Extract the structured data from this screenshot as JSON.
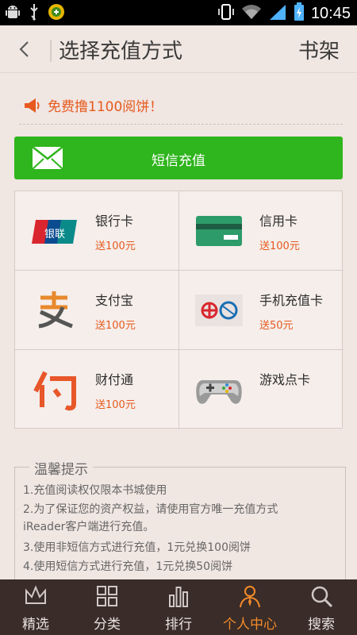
{
  "status_bar": {
    "time": "10:45"
  },
  "header": {
    "title": "选择充值方式",
    "right_link": "书架"
  },
  "promo": {
    "text": "免费撸1100阅饼！"
  },
  "sms": {
    "label": "短信充值"
  },
  "methods": [
    {
      "name": "银行卡",
      "bonus": "送100元",
      "icon": "unionpay-icon"
    },
    {
      "name": "信用卡",
      "bonus": "送100元",
      "icon": "credit-card-icon"
    },
    {
      "name": "支付宝",
      "bonus": "送100元",
      "icon": "alipay-icon"
    },
    {
      "name": "手机充值卡",
      "bonus": "送50元",
      "icon": "mobile-recharge-card-icon"
    },
    {
      "name": "财付通",
      "bonus": "送100元",
      "icon": "tenpay-icon"
    },
    {
      "name": "游戏点卡",
      "bonus": "",
      "icon": "gamepad-icon"
    }
  ],
  "tips": {
    "title": "温馨提示",
    "items": [
      "1.充值阅读权仅限本书城使用",
      "2.为了保证您的资产权益，请使用官方唯一充值方式",
      "iReader客户端进行充值。",
      "3.使用非短信方式进行充值，1元兑换100阅饼",
      "4.使用短信方式进行充值，1元兑换50阅饼"
    ]
  },
  "nav": [
    {
      "label": "精选",
      "icon": "crown-icon"
    },
    {
      "label": "分类",
      "icon": "grid-icon"
    },
    {
      "label": "排行",
      "icon": "bar-chart-icon"
    },
    {
      "label": "个人中心",
      "icon": "person-icon",
      "active": true
    },
    {
      "label": "搜索",
      "icon": "search-icon"
    }
  ],
  "colors": {
    "accent_orange": "#e65a1f",
    "sms_green": "#2fb51d",
    "nav_bg": "#3a2c28",
    "nav_active": "#f28b2a"
  }
}
